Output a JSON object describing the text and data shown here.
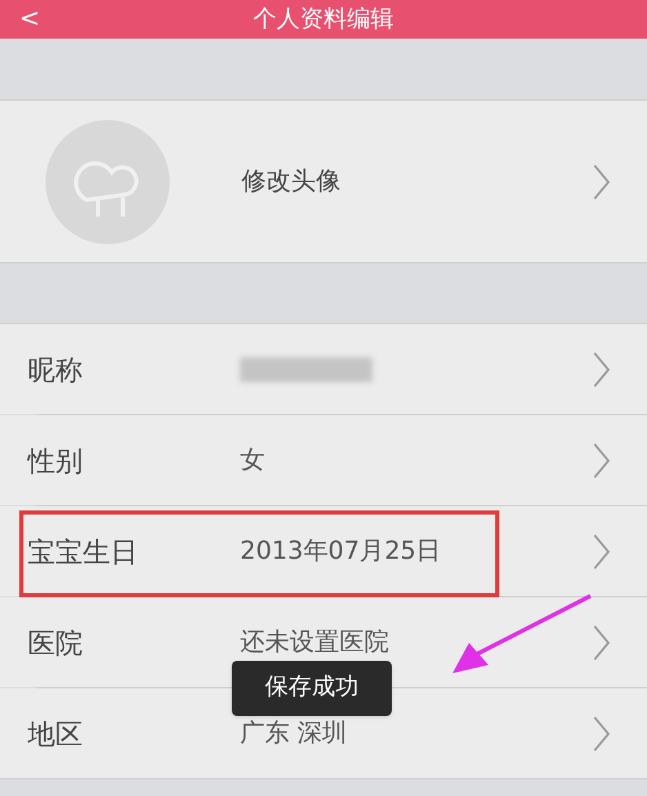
{
  "header": {
    "back": "<",
    "title": "个人资料编辑"
  },
  "avatar_row": {
    "label": "修改头像"
  },
  "rows": [
    {
      "label": "昵称",
      "kind": "blurred",
      "highlighted": false
    },
    {
      "label": "性别",
      "kind": "text",
      "value": "女",
      "highlighted": false
    },
    {
      "label": "宝宝生日",
      "kind": "text",
      "value": "2013年07月25日",
      "highlighted": true
    },
    {
      "label": "医院",
      "kind": "text",
      "value": "还未设置医院",
      "highlighted": false
    },
    {
      "label": "地区",
      "kind": "text",
      "value": "广东 深圳",
      "highlighted": false
    }
  ],
  "arrow_annotation": true,
  "toast": "保存成功"
}
